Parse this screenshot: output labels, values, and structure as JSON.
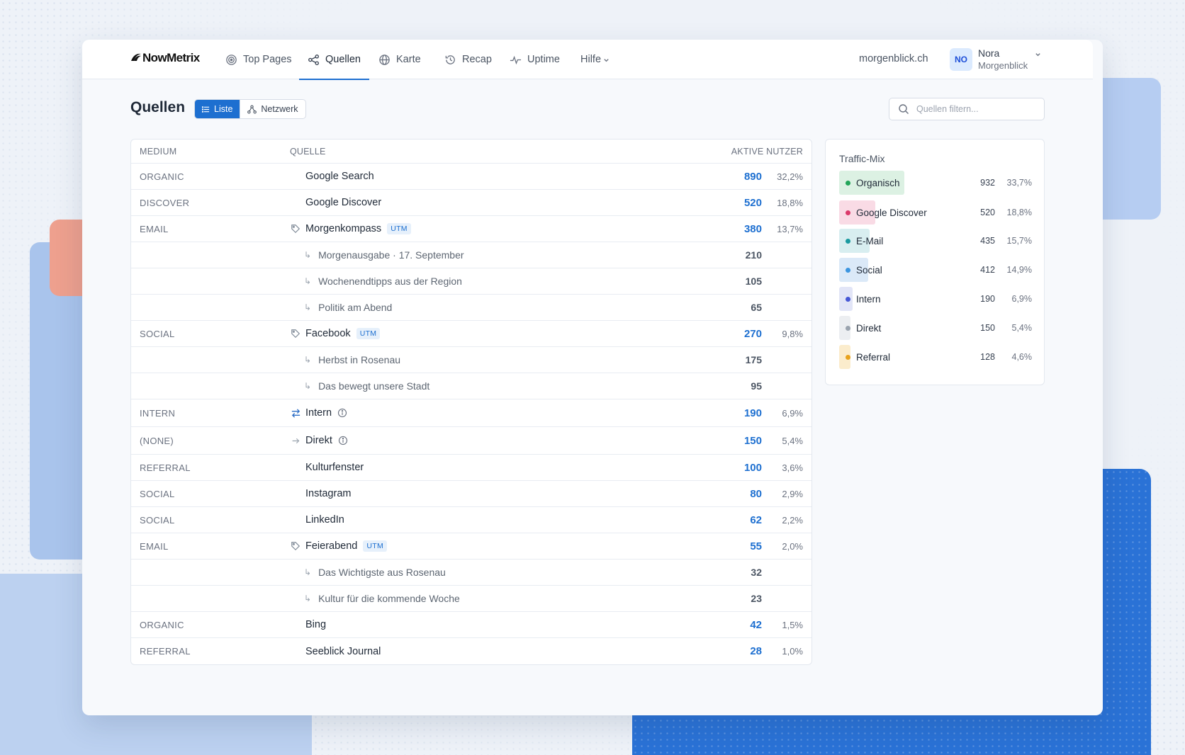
{
  "app": {
    "logo": "NowMetrix"
  },
  "nav": {
    "items": [
      {
        "label": "Top Pages",
        "icon": "target-icon"
      },
      {
        "label": "Quellen",
        "icon": "share-icon",
        "active": true
      },
      {
        "label": "Karte",
        "icon": "globe-icon"
      },
      {
        "label": "Recap",
        "icon": "history-icon"
      },
      {
        "label": "Uptime",
        "icon": "pulse-icon"
      },
      {
        "label": "Hilfe",
        "icon": "chevron-down-icon"
      }
    ],
    "domain": "morgenblick.ch",
    "user": {
      "initials": "NO",
      "name": "Nora",
      "org": "Morgenblick"
    }
  },
  "page": {
    "title": "Quellen",
    "view_toggle": {
      "list": "Liste",
      "network": "Netzwerk",
      "active": "list"
    },
    "search": {
      "placeholder": "Quellen filtern...",
      "value": ""
    }
  },
  "table": {
    "headers": {
      "medium": "MEDIUM",
      "source": "QUELLE",
      "users": "AKTIVE NUTZER"
    },
    "rows": [
      {
        "medium": "ORGANIC",
        "source": "Google Search",
        "value": "890",
        "pct": "32,2%"
      },
      {
        "medium": "DISCOVER",
        "source": "Google Discover",
        "value": "520",
        "pct": "18,8%"
      },
      {
        "medium": "EMAIL",
        "source": "Morgenkompass",
        "icon": "tag-icon",
        "utm": "UTM",
        "value": "380",
        "pct": "13,7%"
      },
      {
        "sub": true,
        "source": "Morgenausgabe · 17. September",
        "value": "210"
      },
      {
        "sub": true,
        "source": "Wochenendtipps aus der Region",
        "value": "105"
      },
      {
        "sub": true,
        "source": "Politik am Abend",
        "value": "65"
      },
      {
        "medium": "SOCIAL",
        "source": "Facebook",
        "icon": "tag-icon",
        "utm": "UTM",
        "value": "270",
        "pct": "9,8%"
      },
      {
        "sub": true,
        "source": "Herbst in Rosenau",
        "value": "175"
      },
      {
        "sub": true,
        "source": "Das bewegt unsere Stadt",
        "value": "95"
      },
      {
        "medium": "INTERN",
        "source": "Intern",
        "icon": "swap-icon",
        "info": true,
        "value": "190",
        "pct": "6,9%"
      },
      {
        "medium": "(NONE)",
        "source": "Direkt",
        "icon": "arrow-right-icon",
        "info": true,
        "value": "150",
        "pct": "5,4%"
      },
      {
        "medium": "REFERRAL",
        "source": "Kulturfenster",
        "value": "100",
        "pct": "3,6%"
      },
      {
        "medium": "SOCIAL",
        "source": "Instagram",
        "value": "80",
        "pct": "2,9%"
      },
      {
        "medium": "SOCIAL",
        "source": "LinkedIn",
        "value": "62",
        "pct": "2,2%"
      },
      {
        "medium": "EMAIL",
        "source": "Feierabend",
        "icon": "tag-icon",
        "utm": "UTM",
        "value": "55",
        "pct": "2,0%"
      },
      {
        "sub": true,
        "source": "Das Wichtigste aus Rosenau",
        "value": "32"
      },
      {
        "sub": true,
        "source": "Kultur für die kommende Woche",
        "value": "23"
      },
      {
        "medium": "ORGANIC",
        "source": "Bing",
        "value": "42",
        "pct": "1,5%"
      },
      {
        "medium": "REFERRAL",
        "source": "Seeblick Journal",
        "value": "28",
        "pct": "1,0%"
      }
    ]
  },
  "traffic_mix": {
    "title": "Traffic-Mix",
    "items": [
      {
        "name": "Organisch",
        "value": "932",
        "pct": "33,7%",
        "share": 0.337,
        "dot": "#22a559",
        "bar": "#dcf1e3"
      },
      {
        "name": "Google Discover",
        "value": "520",
        "pct": "18,8%",
        "share": 0.188,
        "dot": "#db3a6b",
        "bar": "#f9dbe5"
      },
      {
        "name": "E-Mail",
        "value": "435",
        "pct": "15,7%",
        "share": 0.157,
        "dot": "#1a9aa0",
        "bar": "#d8eef0"
      },
      {
        "name": "Social",
        "value": "412",
        "pct": "14,9%",
        "share": 0.149,
        "dot": "#3b95e0",
        "bar": "#dbe9f8"
      },
      {
        "name": "Intern",
        "value": "190",
        "pct": "6,9%",
        "share": 0.069,
        "dot": "#4657d6",
        "bar": "#e2e5f7"
      },
      {
        "name": "Direkt",
        "value": "150",
        "pct": "5,4%",
        "share": 0.054,
        "dot": "#9aa3ae",
        "bar": "#eceef1"
      },
      {
        "name": "Referral",
        "value": "128",
        "pct": "4,6%",
        "share": 0.046,
        "dot": "#e8a21c",
        "bar": "#fbeccc"
      }
    ]
  }
}
